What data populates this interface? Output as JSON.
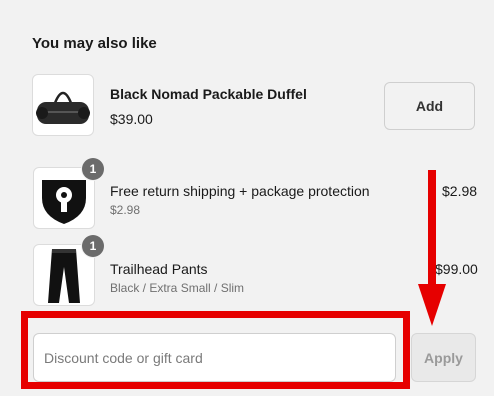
{
  "upsell": {
    "heading": "You may also like",
    "product": {
      "name": "Black Nomad Packable Duffel",
      "price": "$39.00",
      "add_label": "Add",
      "icon": "duffel-bag-icon"
    }
  },
  "cart_items": [
    {
      "name": "Free return shipping + package protection",
      "detail": "$2.98",
      "price": "$2.98",
      "quantity": "1",
      "icon": "shield-lock-icon"
    },
    {
      "name": "Trailhead Pants",
      "detail": "Black / Extra Small / Slim",
      "price": "$99.00",
      "quantity": "1",
      "icon": "pants-icon"
    }
  ],
  "discount": {
    "placeholder": "Discount code or gift card",
    "apply_label": "Apply"
  },
  "annotation_color": "#e60000"
}
